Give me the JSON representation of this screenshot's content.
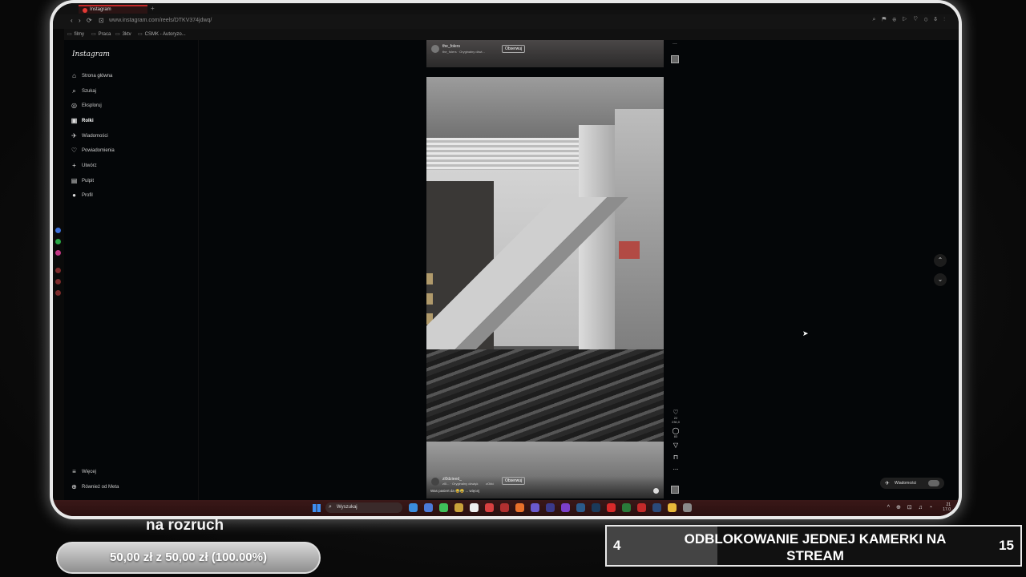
{
  "browser": {
    "tab_title": "Instagram",
    "url": "www.instagram.com/reels/DTKV374jdwq/",
    "nav_back": "‹",
    "nav_forward": "›",
    "nav_reload": "⟳",
    "toolbar_icons": "⌕ ⚑ ⊕ ▷ ♡ ⊙ ⇩ ⋮",
    "bookmarks": [
      "filmy",
      "Praca",
      "3ktv",
      "CSMK - Autoryzo..."
    ]
  },
  "instagram": {
    "logo": "Instagram",
    "nav": [
      {
        "label": "Strona główna",
        "icon": "⌂"
      },
      {
        "label": "Szukaj",
        "icon": "⌕"
      },
      {
        "label": "Eksploruj",
        "icon": "◎"
      },
      {
        "label": "Rolki",
        "icon": "▣"
      },
      {
        "label": "Wiadomości",
        "icon": "✈"
      },
      {
        "label": "Powiadomienia",
        "icon": "♡"
      },
      {
        "label": "Utwórz",
        "icon": "+"
      },
      {
        "label": "Pulpit",
        "icon": "▤"
      },
      {
        "label": "Profil",
        "icon": "●"
      }
    ],
    "nav_bottom": [
      {
        "label": "Więcej",
        "icon": "≡"
      },
      {
        "label": "Również od Meta",
        "icon": "⊕"
      }
    ],
    "prev_reel": {
      "account": "the_folers",
      "audio": "the_folers · Oryginalny dźwi...",
      "follow": "Obserwuj"
    },
    "reel": {
      "account": "zl0dzieed_",
      "audio": "zl0... · Oryginalny dźwięk",
      "extra": "zObić",
      "follow": "Obserwuj",
      "caption": "Was pasiert da 😂😂 ... więcej",
      "likes": "22 236,0",
      "comments": "83"
    },
    "more": "...",
    "messages_label": "Wiadomości",
    "scroll_up": "⌃",
    "scroll_down": "⌄"
  },
  "taskbar": {
    "search_placeholder": "Wyszukaj",
    "tray": "^ ⊕ ⊡ ♫ ◔",
    "clock_time": "21",
    "clock_date": "17.0"
  },
  "stream": {
    "goal_label": "na rozruch",
    "goal_text": "50,00 zł z 50,00 zł (100.00%)",
    "goal_progress": 1.0,
    "sub_current": "4",
    "sub_title": "ODBLOKOWANIE JEDNEJ KAMERKI NA STREAM",
    "sub_target": "15",
    "sub_progress": 0.2667
  },
  "colors": {
    "tab_accent": "#c62828",
    "taskbar": "#2a1010",
    "page_bg": "#040608"
  }
}
